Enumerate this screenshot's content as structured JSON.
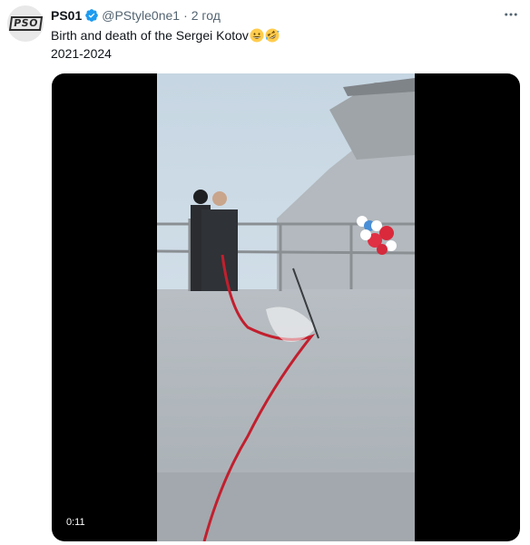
{
  "tweet": {
    "author": {
      "display_name": "PS01",
      "handle": "@PStyle0ne1",
      "verified": true,
      "avatar_text": "PSO"
    },
    "timestamp": "2 год",
    "separator": "·",
    "text_line_1": "Birth and death of the Sergei Kotov",
    "text_emojis": [
      "grinning-face-emoji",
      "rolling-on-floor-laughing-emoji"
    ],
    "text_line_2": "2021-2024"
  },
  "video": {
    "duration": "0:11"
  },
  "colors": {
    "verified_blue": "#1d9bf0",
    "muted_text": "#536471"
  }
}
